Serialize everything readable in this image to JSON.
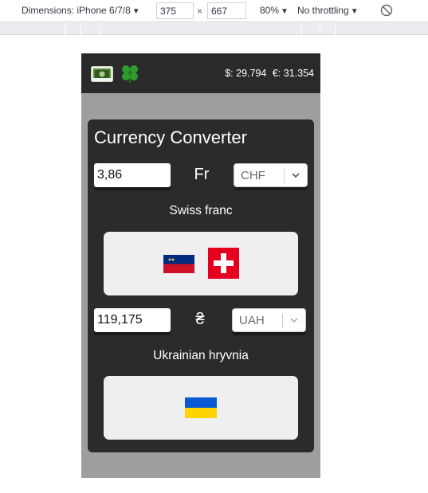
{
  "devtools": {
    "dimensions_label": "Dimensions: iPhone 6/7/8",
    "width_value": "375",
    "height_value": "667",
    "times_sign": "×",
    "zoom_label": "80%",
    "throttling_label": "No throttling",
    "caret": "▼"
  },
  "header": {
    "rates": [
      "$: 29.794",
      "€: 31.354"
    ]
  },
  "converter": {
    "title": "Currency Converter",
    "from": {
      "amount": "3,86",
      "symbol": "Fr",
      "code": "CHF",
      "name": "Swiss franc",
      "flags": [
        "liechtenstein-flag",
        "switzerland-flag"
      ]
    },
    "to": {
      "amount": "119,175",
      "symbol": "₴",
      "code": "UAH",
      "name": "Ukrainian hryvnia",
      "flags": [
        "ukraine-flag"
      ]
    }
  },
  "colors": {
    "header_bg": "#2a2a2a",
    "card_bg": "#2b2b2b",
    "page_bg": "#9e9e9e",
    "flag_box_bg": "#efefef"
  }
}
